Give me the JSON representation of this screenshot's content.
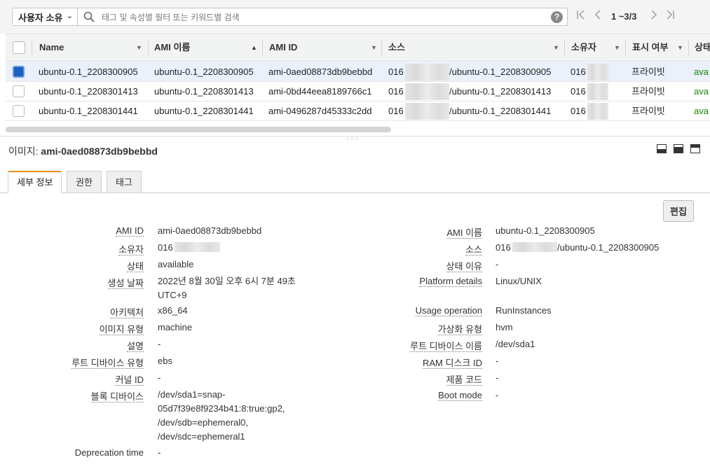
{
  "toolbar": {
    "owner_filter": "사용자 소유",
    "search_placeholder": "태그 및 속성별 필터 또는 키워드별 검색",
    "help": "?",
    "page_info": "1 ~3/3",
    "first_page": "|<",
    "prev_page": "<",
    "next_page": ">",
    "last_page": ">|"
  },
  "table": {
    "columns": [
      "Name",
      "AMI 이름",
      "AMI ID",
      "소스",
      "소유자",
      "표시 여부",
      "상태"
    ],
    "sorted_column": "AMI 이름",
    "rows": [
      {
        "selected": true,
        "name": "ubuntu-0.1_2208300905",
        "ami_name": "ubuntu-0.1_2208300905",
        "ami_id": "ami-0aed08873db9bebbd",
        "source_prefix": "016",
        "source_suffix": "/ubuntu-0.1_2208300905",
        "owner": "016",
        "visibility": "프라이빗",
        "status": "ava"
      },
      {
        "selected": false,
        "name": "ubuntu-0.1_2208301413",
        "ami_name": "ubuntu-0.1_2208301413",
        "ami_id": "ami-0bd44eea8189766c1",
        "source_prefix": "016",
        "source_suffix": "/ubuntu-0.1_2208301413",
        "owner": "016",
        "visibility": "프라이빗",
        "status": "ava"
      },
      {
        "selected": false,
        "name": "ubuntu-0.1_2208301441",
        "ami_name": "ubuntu-0.1_2208301441",
        "ami_id": "ami-0496287d45333c2dd",
        "source_prefix": "016",
        "source_suffix": "/ubuntu-0.1_2208301441",
        "owner": "016",
        "visibility": "프라이빗",
        "status": "ava"
      }
    ]
  },
  "detail": {
    "title_label": "이미지:",
    "title_value": "ami-0aed08873db9bebbd",
    "tabs": [
      "세부 정보",
      "권한",
      "태그"
    ],
    "active_tab": "세부 정보",
    "edit_button": "편집",
    "left_fields": [
      {
        "label": "AMI ID",
        "value": "ami-0aed08873db9bebbd"
      },
      {
        "label": "소유자",
        "value": "016"
      },
      {
        "label": "상태",
        "value": "available"
      },
      {
        "label": "생성 날짜",
        "value": "2022년 8월 30일 오후 6시 7분 49초",
        "value2": "UTC+9"
      },
      {
        "label": "아키텍처",
        "value": "x86_64"
      },
      {
        "label": "이미지 유형",
        "value": "machine"
      },
      {
        "label": "설명",
        "value": "-"
      },
      {
        "label": "루트 디바이스 유형",
        "value": "ebs"
      },
      {
        "label": "커널 ID",
        "value": "-"
      },
      {
        "label": "블록 디바이스",
        "value": "/dev/sda1=snap-",
        "value2": "05d7f39e8f9234b41:8:true:gp2,",
        "value3": "/dev/sdb=ephemeral0,",
        "value4": "/dev/sdc=ephemeral1"
      },
      {
        "label": "Deprecation time",
        "value": "-"
      }
    ],
    "right_fields": [
      {
        "label": "AMI 이름",
        "value": "ubuntu-0.1_2208300905"
      },
      {
        "label": "소스",
        "value": "016",
        "value_suffix": "/ubuntu-0.1_2208300905"
      },
      {
        "label": "상태 이유",
        "value": "-"
      },
      {
        "label": "Platform details",
        "value": "Linux/UNIX"
      },
      {
        "label": "Usage operation",
        "value": "RunInstances"
      },
      {
        "label": "가상화 유형",
        "value": "hvm"
      },
      {
        "label": "루트 디바이스 이름",
        "value": "/dev/sda1"
      },
      {
        "label": "RAM 디스크 ID",
        "value": "-"
      },
      {
        "label": "제품 코드",
        "value": "-"
      },
      {
        "label": "Boot mode",
        "value": "-"
      }
    ]
  },
  "colors": {
    "selected_row": "#eaf1fb",
    "status_green": "#1d8102",
    "tab_accent": "#e88b1a",
    "checkbox_blue": "#1a5fc4"
  }
}
